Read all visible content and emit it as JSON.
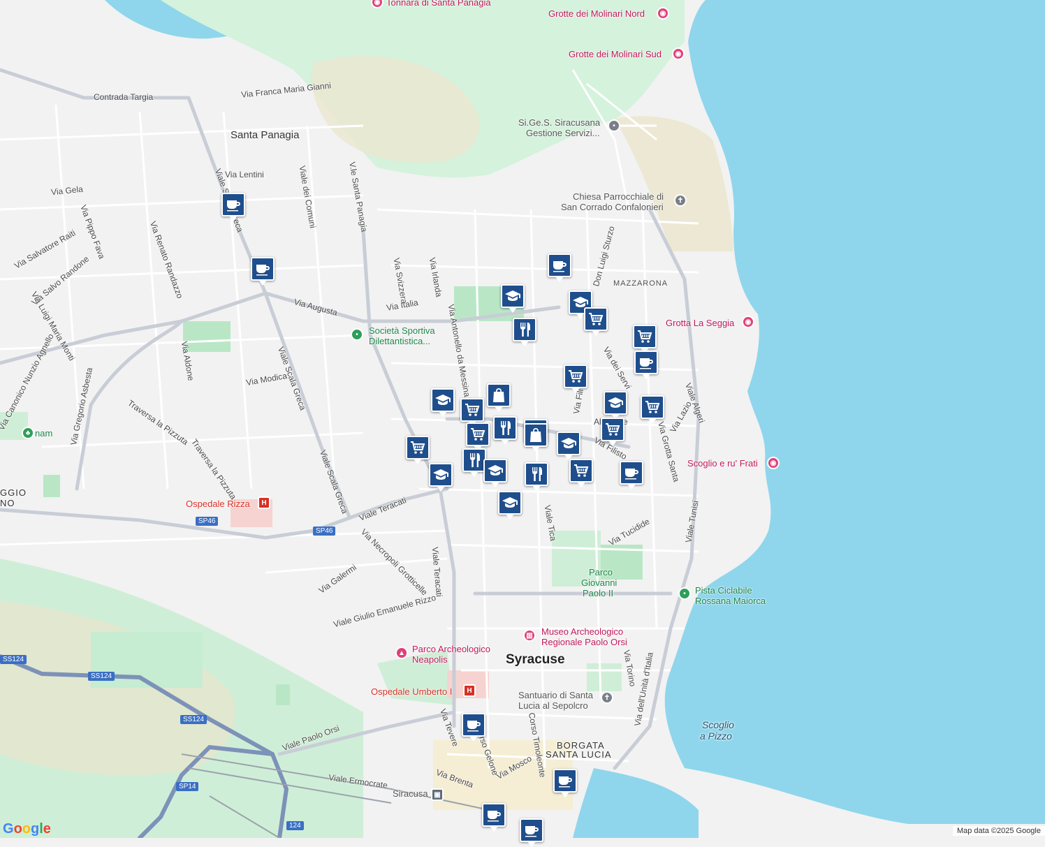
{
  "map": {
    "colors": {
      "water": "#8fd6ec",
      "land": "#f2f2f2",
      "park": "#c9efd3",
      "road": "#ffffff",
      "road_major": "#c8cdd6",
      "pin": "#1f4e8c"
    },
    "place_labels": {
      "santa_panagia": "Santa Panagia",
      "mazzarona": "MAZZARONA",
      "syracuse": "Syracuse",
      "borgata_1": "BORGATA",
      "borgata_2": "SANTA LUCIA",
      "grottasanta_1": "GGIO",
      "grottasanta_2": "NO",
      "scoglio_1": "Scoglio",
      "scoglio_2": "a Pizzo"
    },
    "streets": {
      "contrada_targia": "Contrada Targia",
      "via_franca": "Via Franca Maria Gianni",
      "via_gela": "Via Gela",
      "via_lentini": "Via Lentini",
      "viale_greca": "Viale Scala Greca",
      "viale_comuni": "Viale dei Comuni",
      "vle_santa_panagia": "V.le Santa Panagia",
      "via_pippo_fava": "Via Pippo Fava",
      "via_salvatore_raiti": "Via Salvatore Raiti",
      "via_renato_randazzo": "Via Renato Randazzo",
      "via_salvo_randone": "Via Salvo Randone",
      "via_luigi_monti": "Via Luigi Maria Monti",
      "via_canonico": "Via Canonico Nunzio Agnello",
      "via_gregorio": "Via Gregorio Asbesta",
      "via_aldone": "Via Aldone",
      "via_augusta": "Via Augusta",
      "via_italia": "Via Italia",
      "via_svizzera": "Via Svizzera",
      "via_irlanda": "Via Irlanda",
      "via_antonello": "Via Antonello da Messina",
      "via_modica": "Via Modica",
      "traversa_1": "Traversa la Pizzuta",
      "traversa_2": "Traversa la Pizzuta",
      "viale_scala_greca_2": "Viale Scala Greca",
      "viale_scala_greca_3": "Viale Scala Greca",
      "viale_teracati": "Viale Teracati",
      "viale_teracati_2": "Viale Teracati",
      "via_necropoli": "Via Necropoli Grotticelle",
      "via_galermi": "Via Galermi",
      "viale_giulio": "Viale Giulio Emanuele Rizzo",
      "viale_tica": "Viale Tica",
      "via_tucidide": "Via Tucidide",
      "via_filisto": "Via Filisto",
      "via_grotta_santa": "Via Grotta Santa",
      "viale_algeri": "Viale Algeri",
      "viale_tunisi": "Viale Tunisi",
      "via_lazio": "Via Lazio",
      "via_dei_servi": "Via dei Servi",
      "don_luigi": "Don Luigi Sturzo",
      "via_unita": "Via dell'Unità d'Italia",
      "via_torino": "Via Torino",
      "viale_paolo_orsi": "Viale Paolo Orsi",
      "viale_ermocrate": "Viale Ermocrate",
      "via_brenta": "Via Brenta",
      "via_mosco": "Via Mosco",
      "corso_timoleonte": "Corso Timoleonte",
      "via_tevere": "Via Tevere",
      "corso_gelone": "Corso Gelone",
      "via_alcibiade": "Alcibiade",
      "via_filippo": "Via Fili"
    },
    "road_shields": {
      "sp46": "SP46",
      "ss124_a": "SS124",
      "ss124_b": "SS124",
      "ss124_c": "SS124",
      "sp14": "SP14",
      "ss124_d": "124"
    },
    "pois": {
      "tonnara": "Tonnara di Santa Panagia",
      "grotte_nord": "Grotte dei Molinari Nord",
      "grotte_sud": "Grotte dei Molinari Sud",
      "sigess_1": "Si.Ge.S. Siracusana",
      "sigess_2": "Gestione Servizi...",
      "chiesa_1": "Chiesa Parrocchiale di",
      "chiesa_2": "San Corrado Confalonieri",
      "grotta_seggia": "Grotta La Seggia",
      "societa_1": "Società Sportiva",
      "societa_2": "Dilettantistica...",
      "scoglio_frati": "Scoglio e ru' Frati",
      "ospedale_rizza": "Ospedale Rizza",
      "parco_gp_1": "Parco",
      "parco_gp_2": "Giovanni",
      "parco_gp_3": "Paolo II",
      "pista_1": "Pista Ciclabile",
      "pista_2": "Rossana Maiorca",
      "museo_1": "Museo Archeologico",
      "museo_2": "Regionale Paolo Orsi",
      "parco_neapolis_1": "Parco Archeologico",
      "parco_neapolis_2": "Neapolis",
      "ospedale_umberto": "Ospedale Umberto I",
      "santuario_1": "Santuario di Santa",
      "santuario_2": "Lucia al Sepolcro",
      "siracusa_station": "Siracusa",
      "nam": "nam"
    },
    "markers": [
      {
        "type": "cafe",
        "icon": "coffee-cup-icon"
      },
      {
        "type": "cafe",
        "icon": "coffee-cup-icon"
      },
      {
        "type": "cafe",
        "icon": "coffee-cup-icon"
      },
      {
        "type": "school",
        "icon": "graduation-cap-icon"
      },
      {
        "type": "school",
        "icon": "graduation-cap-icon"
      },
      {
        "type": "grocery",
        "icon": "shopping-cart-icon"
      },
      {
        "type": "restaurant",
        "icon": "fork-knife-icon"
      },
      {
        "type": "grocery",
        "icon": "shopping-cart-icon"
      },
      {
        "type": "cafe",
        "icon": "coffee-cup-icon"
      },
      {
        "type": "grocery",
        "icon": "shopping-cart-icon"
      },
      {
        "type": "school",
        "icon": "graduation-cap-icon"
      },
      {
        "type": "shopping",
        "icon": "shopping-bag-icon"
      },
      {
        "type": "grocery",
        "icon": "shopping-cart-icon"
      },
      {
        "type": "shopping",
        "icon": "shopping-bag-icon"
      },
      {
        "type": "grocery",
        "icon": "shopping-cart-icon"
      },
      {
        "type": "restaurant",
        "icon": "fork-knife-icon"
      },
      {
        "type": "shopping",
        "icon": "shopping-bag-icon"
      },
      {
        "type": "school",
        "icon": "graduation-cap-icon"
      },
      {
        "type": "restaurant",
        "icon": "fork-knife-icon"
      },
      {
        "type": "school",
        "icon": "graduation-cap-icon"
      },
      {
        "type": "grocery",
        "icon": "shopping-cart-icon"
      },
      {
        "type": "school",
        "icon": "graduation-cap-icon"
      },
      {
        "type": "grocery",
        "icon": "shopping-cart-icon"
      },
      {
        "type": "restaurant",
        "icon": "fork-knife-icon"
      },
      {
        "type": "school",
        "icon": "graduation-cap-icon"
      },
      {
        "type": "cafe",
        "icon": "coffee-cup-icon"
      },
      {
        "type": "grocery",
        "icon": "shopping-cart-icon"
      },
      {
        "type": "school",
        "icon": "graduation-cap-icon"
      },
      {
        "type": "grocery",
        "icon": "shopping-cart-icon"
      },
      {
        "type": "cafe",
        "icon": "coffee-cup-icon"
      },
      {
        "type": "cafe",
        "icon": "coffee-cup-icon"
      },
      {
        "type": "cafe",
        "icon": "coffee-cup-icon"
      },
      {
        "type": "cafe",
        "icon": "coffee-cup-icon"
      }
    ],
    "google_logo": "Google",
    "attribution": "Map data ©2025 Google"
  }
}
